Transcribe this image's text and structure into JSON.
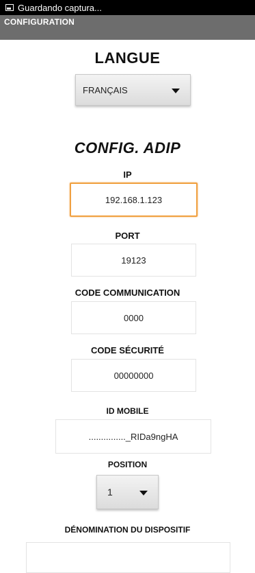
{
  "status_bar": {
    "icon": "screenshot-icon",
    "text": "Guardando captura..."
  },
  "app_bar": {
    "title": "CONFIGURATION"
  },
  "language": {
    "heading": "LANGUE",
    "selected": "FRANÇAIS"
  },
  "config": {
    "heading": "CONFIG. ADIP",
    "ip": {
      "label": "IP",
      "value": "192.168.1.123"
    },
    "port": {
      "label": "PORT",
      "value": "19123"
    },
    "code_communication": {
      "label": "CODE  COMMUNICATION",
      "value": "0000"
    },
    "code_securite": {
      "label": "CODE  SÉCURITÉ",
      "value": "00000000"
    },
    "id_mobile": {
      "label": "ID MOBILE",
      "value": "..............._RIDa9ngHA"
    },
    "position": {
      "label": "POSITION",
      "selected": "1"
    },
    "denomination": {
      "label": "DÉNOMINATION DU DISPOSITIF",
      "value": ""
    }
  },
  "colors": {
    "focus_border": "#f0a040",
    "app_bar": "#6d6d6d"
  }
}
